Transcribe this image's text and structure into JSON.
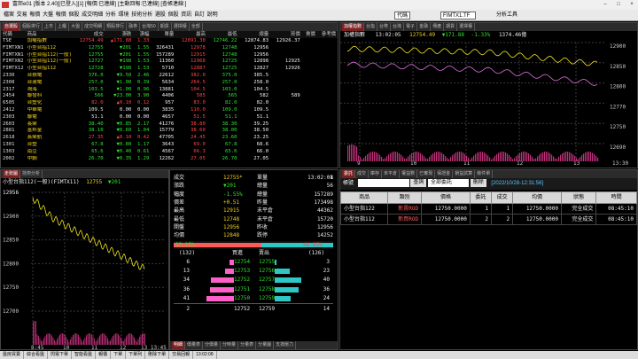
{
  "window": {
    "title": "富邦e01 [版本 2.40][已登入][1] [報價:已連線] [主動回報:已連線] [查帳連線:]"
  },
  "menu": {
    "items": [
      "檔案",
      "交易",
      "報價",
      "大盤",
      "報價",
      "個股",
      "成交明細",
      "分析",
      "環境",
      "技術分析",
      "選股",
      "個股",
      "資訊",
      "自訂",
      "說明"
    ],
    "symbol_label": "代碼",
    "symbol_value": "FIMTX1.TF",
    "tool_label": "分析工具"
  },
  "quotes": {
    "tabs": [
      "自選股",
      "個股排行",
      "上市",
      "上櫃",
      "大盤",
      "成交明細",
      "類股排行",
      "融券",
      "台灣50",
      "期貨",
      "選擇權",
      "全部"
    ],
    "headers": [
      "代碼",
      "商品",
      "成交",
      "漲跌",
      "漲幅",
      "單量",
      "最高",
      "最低",
      "總量",
      "買價",
      "賣價",
      "參考價"
    ],
    "rows": [
      {
        "code": "TSE",
        "name": "加權指數",
        "price": "12754.49",
        "chg": "▲171.88",
        "pct": "1.33",
        "vol": "",
        "high": "12891.38",
        "low": "12746.22",
        "total": "12874.83",
        "bid": "12926.37",
        "ask": "",
        "ref": ""
      },
      {
        "code": "FIMTXN1",
        "name": "小型台指112",
        "price": "12755",
        "chg": "▼201",
        "pct": "1.55",
        "vol": "326431",
        "high": "12978",
        "low": "12748",
        "total": "12956",
        "bid": "",
        "ask": "",
        "ref": ""
      },
      {
        "code": "FIMTXN1",
        "name": "小型台指112(一般)",
        "price": "12755",
        "chg": "▼201",
        "pct": "1.55",
        "vol": "157289",
        "high": "12915",
        "low": "12748",
        "total": "12956",
        "bid": "",
        "ask": "",
        "ref": ""
      },
      {
        "code": "FIMTXN2",
        "name": "小型台指112(一般)",
        "price": "12727",
        "chg": "▼198",
        "pct": "1.53",
        "vol": "11360",
        "high": "12968",
        "low": "12725",
        "total": "12898",
        "bid": "12925",
        "ask": "",
        "ref": ""
      },
      {
        "code": "FIMTX12",
        "name": "小型台指112",
        "price": "12728",
        "chg": "▼198",
        "pct": "1.53",
        "vol": "5710",
        "high": "12887",
        "low": "12725",
        "total": "12827",
        "bid": "12926",
        "ask": "",
        "ref": ""
      },
      {
        "code": "2330",
        "name": "台積電",
        "price": "376.0",
        "chg": "▼9.50",
        "pct": "2.46",
        "vol": "22612",
        "high": "382.0",
        "low": "375.0",
        "total": "385.5",
        "bid": "",
        "ask": "",
        "ref": ""
      },
      {
        "code": "2308",
        "name": "台達電",
        "price": "257.0",
        "chg": "▼1.00",
        "pct": "0.39",
        "vol": "5634",
        "high": "264.5",
        "low": "257.0",
        "total": "258.0",
        "bid": "",
        "ask": "",
        "ref": ""
      },
      {
        "code": "2317",
        "name": "鴻海",
        "price": "103.5",
        "chg": "▼1.00",
        "pct": "0.96",
        "vol": "13881",
        "high": "104.5",
        "low": "103.0",
        "total": "104.5",
        "bid": "",
        "ask": "",
        "ref": ""
      },
      {
        "code": "2454",
        "name": "聯發科",
        "price": "566",
        "chg": "▼23.00",
        "pct": "3.90",
        "vol": "4406",
        "high": "585",
        "low": "565",
        "total": "582",
        "bid": "589",
        "ask": "",
        "ref": ""
      },
      {
        "code": "6505",
        "name": "台塑化",
        "price": "82.0",
        "chg": "▲0.10",
        "pct": "0.12",
        "vol": "957",
        "high": "83.0",
        "low": "82.0",
        "total": "82.0",
        "bid": "",
        "ask": "",
        "ref": ""
      },
      {
        "code": "2412",
        "name": "中華電",
        "price": "109.5",
        "chg": "0.00",
        "pct": "0.00",
        "vol": "3835",
        "high": "110.0",
        "low": "109.0",
        "total": "109.5",
        "bid": "",
        "ask": "",
        "ref": ""
      },
      {
        "code": "2303",
        "name": "聯電",
        "price": "51.1",
        "chg": "0.00",
        "pct": "0.00",
        "vol": "4657",
        "high": "51.5",
        "low": "51.1",
        "total": "51.1",
        "bid": "",
        "ask": "",
        "ref": ""
      },
      {
        "code": "2603",
        "name": "長榮",
        "price": "38.40",
        "chg": "▼0.85",
        "pct": "2.17",
        "vol": "41276",
        "high": "38.80",
        "low": "38.30",
        "total": "39.25",
        "bid": "",
        "ask": "",
        "ref": ""
      },
      {
        "code": "2881",
        "name": "富邦金",
        "price": "38.10",
        "chg": "▼0.60",
        "pct": "1.04",
        "vol": "15779",
        "high": "38.60",
        "low": "38.00",
        "total": "38.50",
        "bid": "",
        "ask": "",
        "ref": ""
      },
      {
        "code": "2618",
        "name": "長榮航",
        "price": "27.35",
        "chg": "▲0.10",
        "pct": "0.42",
        "vol": "47705",
        "high": "24.45",
        "low": "23.60",
        "total": "23.25",
        "bid": "",
        "ask": "",
        "ref": ""
      },
      {
        "code": "1301",
        "name": "台塑",
        "price": "67.8",
        "chg": "▼0.80",
        "pct": "1.17",
        "vol": "3643",
        "high": "69.0",
        "low": "67.8",
        "total": "68.6",
        "bid": "",
        "ask": "",
        "ref": ""
      },
      {
        "code": "1303",
        "name": "南亞",
        "price": "65.6",
        "chg": "▼0.40",
        "pct": "0.61",
        "vol": "4567",
        "high": "66.3",
        "low": "65.6",
        "total": "66.0",
        "bid": "",
        "ask": "",
        "ref": ""
      },
      {
        "code": "2002",
        "name": "中鋼",
        "price": "26.70",
        "chg": "▼0.35",
        "pct": "1.29",
        "vol": "12262",
        "high": "27.05",
        "low": "26.70",
        "total": "27.05",
        "bid": "",
        "ask": "",
        "ref": ""
      }
    ]
  },
  "index_chart": {
    "tabs": [
      "加權指數",
      "台指",
      "台幣",
      "台灣",
      "電子",
      "金融",
      "傳產",
      "期貨",
      "選擇權"
    ],
    "header": {
      "name": "加權指數",
      "time": "13:02:05",
      "price": "12754.49",
      "change": "▼171.88",
      "pct": "-1.33%",
      "volume": "1374.46億"
    },
    "y_labels": [
      "12900",
      "12850",
      "12800",
      "12770",
      "12750",
      "12690"
    ],
    "x_labels": [
      "9",
      "10",
      "11",
      "12",
      "13",
      "13:30"
    ]
  },
  "order_panel": {
    "tabs": [
      "委託",
      "成交",
      "庫存",
      "未平倉",
      "權益數",
      "已實現",
      "保證金",
      "損益試算",
      "條件單"
    ],
    "account_label": "帳號",
    "query_label": "查詢",
    "filter_value": "全部委託",
    "delete_label": "刪除",
    "time_label": "[2022/10/28-12:31:56]",
    "headers": [
      "商品",
      "類別",
      "價格",
      "委託",
      "成交",
      "均價",
      "狀態",
      "時間"
    ],
    "rows": [
      {
        "product": "小型台指122",
        "type": "新賣ROD",
        "price": "12750.0000",
        "qty": "1",
        "filled": "1",
        "avg": "12750.0000",
        "status": "完全成交",
        "time": "08:45:10"
      },
      {
        "product": "小型台指112",
        "type": "新買ROD",
        "price": "12750.0000",
        "qty": "2",
        "filled": "2",
        "avg": "12750.0000",
        "status": "完全成交",
        "time": "08:45:10"
      }
    ]
  },
  "futures_chart": {
    "tabs": [
      "走勢圖",
      "技術分析"
    ],
    "title": "小型台指112(一般)(FIMTX11)",
    "price": "12755",
    "change": "▼201",
    "y_labels": [
      "12956",
      "12900",
      "12850",
      "12800",
      "12750",
      "12700"
    ],
    "x_labels": [
      "8:45",
      "10",
      "11",
      "12",
      "13 13:45"
    ]
  },
  "detail": {
    "time_label": "成交",
    "time": "13:02:08",
    "rows": [
      {
        "l": "成交",
        "v": "12755*",
        "r": "單量",
        "rv": "1"
      },
      {
        "l": "漲跌",
        "v": "▼201",
        "r": "總量",
        "rv": "56"
      },
      {
        "l": "幅度",
        "v": "-1.55%",
        "r": "總量",
        "rv": "157289"
      },
      {
        "l": "價差",
        "v": "+0.51",
        "r": "昨量",
        "rv": "173498"
      },
      {
        "l": "最高",
        "v": "12915",
        "r": "未平倉",
        "rv": "44362"
      },
      {
        "l": "最低",
        "v": "12748",
        "r": "未平倉",
        "rv": "15720"
      },
      {
        "l": "開盤",
        "v": "12956",
        "r": "昨收",
        "rv": "12956"
      },
      {
        "l": "均價",
        "v": "12848",
        "r": "跌停",
        "rv": "14252"
      }
    ],
    "buy_pct": "55.15%",
    "sell_pct": "44.85%",
    "book_head": {
      "bid_count": "(132)",
      "bid": "買進",
      "ask": "賣出",
      "ask_count": "(126)"
    },
    "book": [
      {
        "bq": "6",
        "bp": "12754",
        "ap": "12755",
        "aq": "3"
      },
      {
        "bq": "13",
        "bp": "12753",
        "ap": "12756",
        "aq": "23"
      },
      {
        "bq": "34",
        "bp": "12752",
        "ap": "12757",
        "aq": "40"
      },
      {
        "bq": "36",
        "bp": "12751",
        "ap": "12758",
        "aq": "36"
      },
      {
        "bq": "41",
        "bp": "12750",
        "ap": "12759",
        "aq": "24"
      }
    ],
    "book_total": {
      "bq": "2",
      "bp": "12752",
      "ap": "12759",
      "aq": "14"
    },
    "bottom_tabs": [
      "明細",
      "價量表",
      "分價量",
      "分時量",
      "分量表",
      "分量圖",
      "支撐壓力"
    ]
  },
  "statusbar": {
    "items": [
      "盤房買賣",
      "綜合看盤",
      "閃電下單",
      "智能看盤",
      "報價",
      "下單",
      "下單列",
      "刪除下單",
      "交易回報",
      "13:02:08"
    ]
  },
  "colors": {
    "up": "#ff4444",
    "down": "#2de32d",
    "price_line": "#f2e51c",
    "avg_line": "#e06ee0",
    "active_tab": "#7a2020"
  }
}
